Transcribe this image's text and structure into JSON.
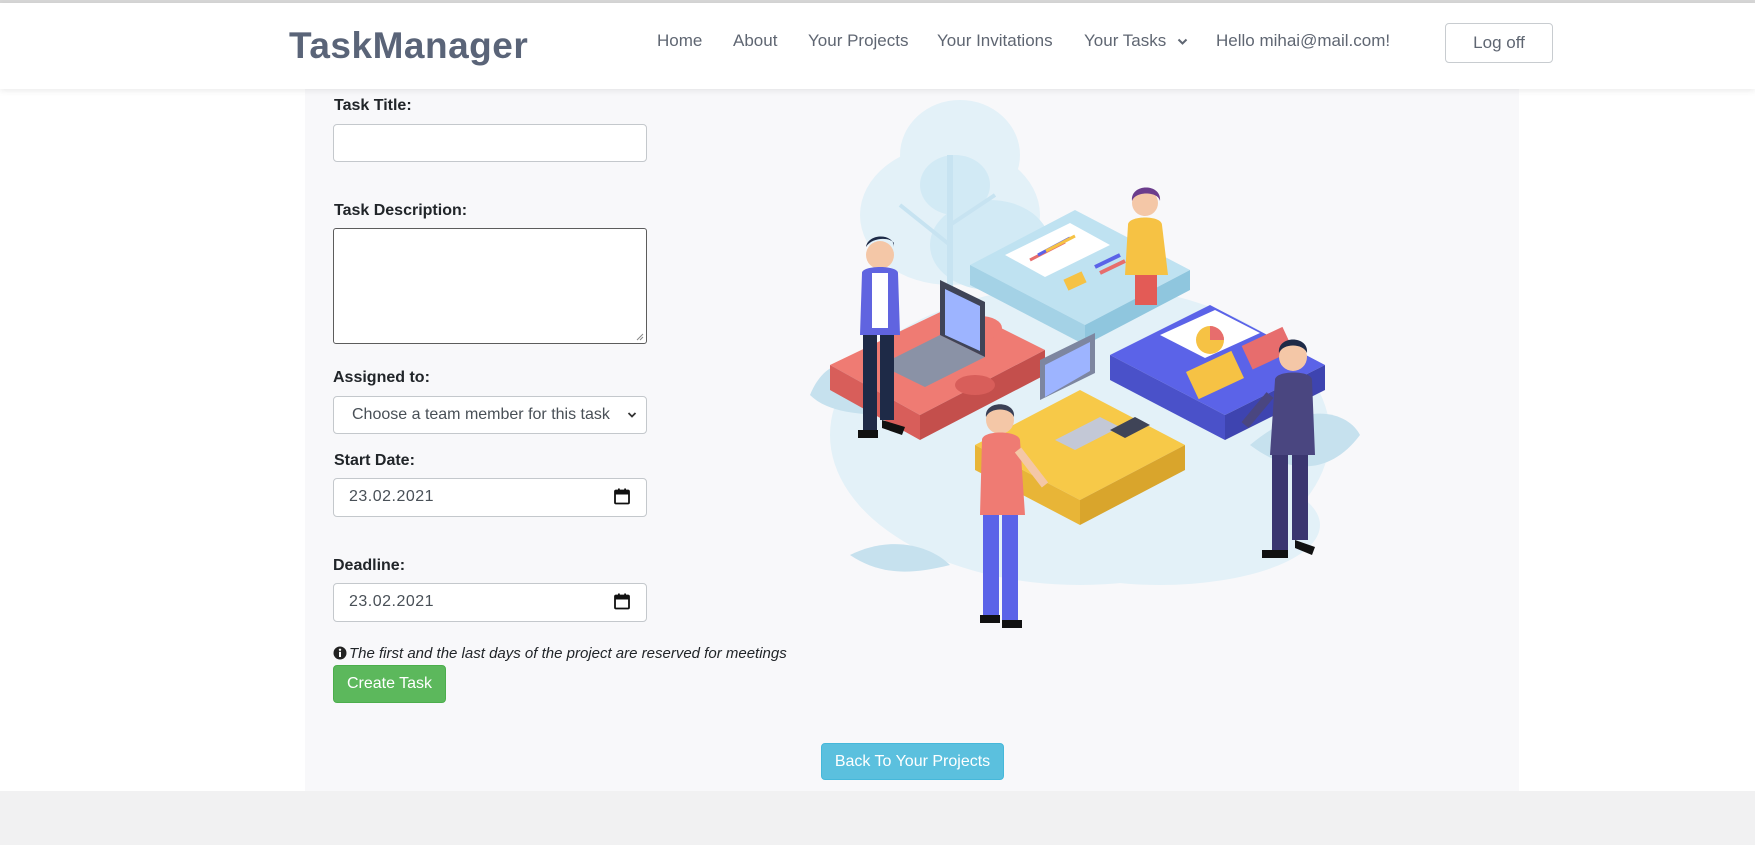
{
  "app": {
    "brand": "TaskManager"
  },
  "nav": {
    "home": "Home",
    "about": "About",
    "projects": "Your Projects",
    "invitations": "Your Invitations",
    "tasks": "Your Tasks",
    "greeting": "Hello mihai@mail.com!",
    "logoff": "Log off"
  },
  "form": {
    "title_label": "Task Title:",
    "title_value": "",
    "description_label": "Task Description:",
    "description_value": "",
    "assigned_label": "Assigned to:",
    "assigned_selected": "Choose a team member for this task",
    "start_label": "Start Date:",
    "start_value": "23.02.2021",
    "deadline_label": "Deadline:",
    "deadline_value": "23.02.2021",
    "note": "The first and the last days of the project are reserved for meetings",
    "create_button": "Create Task"
  },
  "footer": {
    "back_button": "Back To Your Projects"
  },
  "colors": {
    "create_button": "#5cb85c",
    "back_button": "#5bc0de",
    "brand": "#5a6478"
  },
  "icons": {
    "tasks_dropdown": "chevron-down-icon",
    "select_dropdown": "chevron-down-icon",
    "date_picker": "calendar-icon",
    "note": "info-icon"
  }
}
